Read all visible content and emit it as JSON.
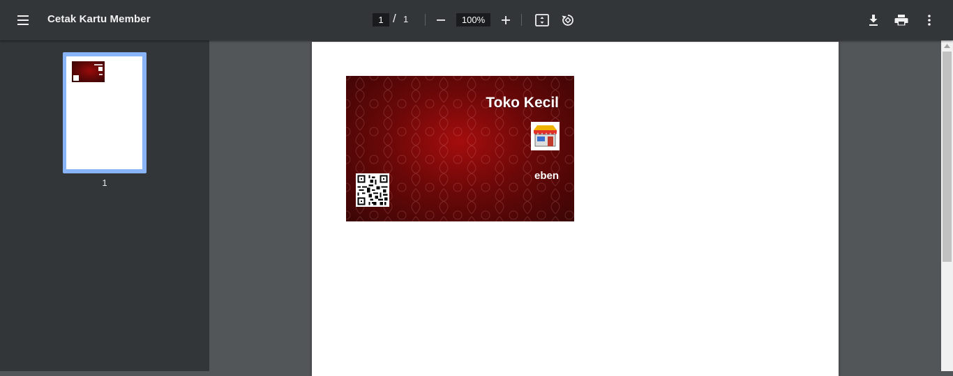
{
  "toolbar": {
    "title": "Cetak Kartu Member",
    "current_page": "1",
    "page_separator": "/",
    "total_pages": "1",
    "zoom": "100%",
    "icons": {
      "menu": "hamburger-menu-icon",
      "zoom_out": "minus-icon",
      "zoom_in": "plus-icon",
      "fit": "fit-to-page-icon",
      "rotate": "rotate-counterclockwise-icon",
      "download": "download-icon",
      "print": "print-icon",
      "more": "more-vertical-icon"
    }
  },
  "sidebar": {
    "thumbnails": [
      {
        "page_number": "1",
        "selected": true
      }
    ]
  },
  "document": {
    "card": {
      "store_name": "Toko Kecil",
      "member_name": "eben",
      "background_color": "#8b0a0a",
      "logo": "store-logo-icon",
      "qr": "qr-code-icon"
    }
  },
  "colors": {
    "toolbar_bg": "#323639",
    "viewer_bg": "#525659",
    "thumb_selected": "#8ab4f8"
  }
}
